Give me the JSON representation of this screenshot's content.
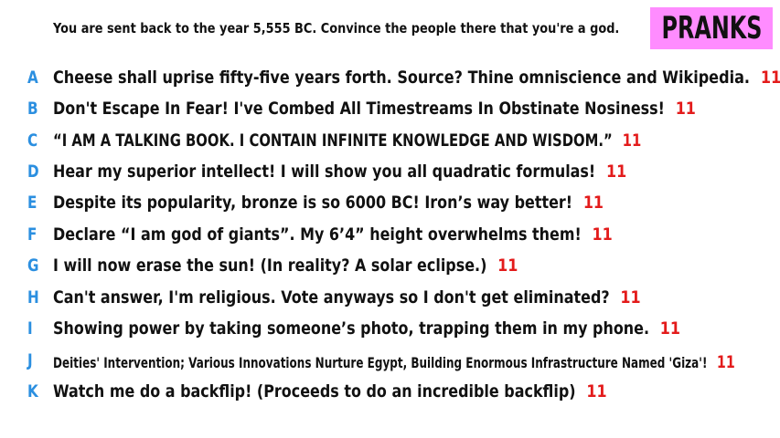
{
  "prompt": "You are sent back to the year 5,555 BC. Convince the people there that you're a god.",
  "badge": {
    "label": "PRANKS",
    "color": "#ff8cff"
  },
  "colors": {
    "letter": "#2b8fe0",
    "score": "#e31b1b",
    "text": "#111111"
  },
  "answers": [
    {
      "letter": "A",
      "text": "Cheese shall uprise fifty-five years forth. Source? Thine omniscience and Wikipedia.",
      "score": "11"
    },
    {
      "letter": "B",
      "text": "Don't Escape In Fear! I've Combed All Timestreams In Obstinate Nosiness!",
      "score": "11"
    },
    {
      "letter": "C",
      "text": "“I AM A TALKING BOOK. I CONTAIN INFINITE KNOWLEDGE AND WISDOM.”",
      "score": "11"
    },
    {
      "letter": "D",
      "text": "Hear my superior intellect! I will show you all quadratic formulas!",
      "score": "11"
    },
    {
      "letter": "E",
      "text": "Despite its popularity, bronze is so 6000 BC! Iron’s way better!",
      "score": "11"
    },
    {
      "letter": "F",
      "text": "Declare “I am god of giants”. My 6’4” height overwhelms them!",
      "score": "11"
    },
    {
      "letter": "G",
      "text": "I will now erase the sun! (In reality? A solar eclipse.)",
      "score": "11"
    },
    {
      "letter": "H",
      "text": "Can't answer, I'm religious. Vote anyways so I don't get eliminated?",
      "score": "11"
    },
    {
      "letter": "I",
      "text": "Showing power by taking someone’s photo, trapping them in my phone.",
      "score": "11"
    },
    {
      "letter": "J",
      "text": "Deities' Intervention; Various Innovations Nurture Egypt, Building Enormous Infrastructure Named 'Giza'!",
      "score": "11"
    },
    {
      "letter": "K",
      "text": "Watch me do a backflip! (Proceeds to do an incredible backflip)",
      "score": "11"
    }
  ]
}
